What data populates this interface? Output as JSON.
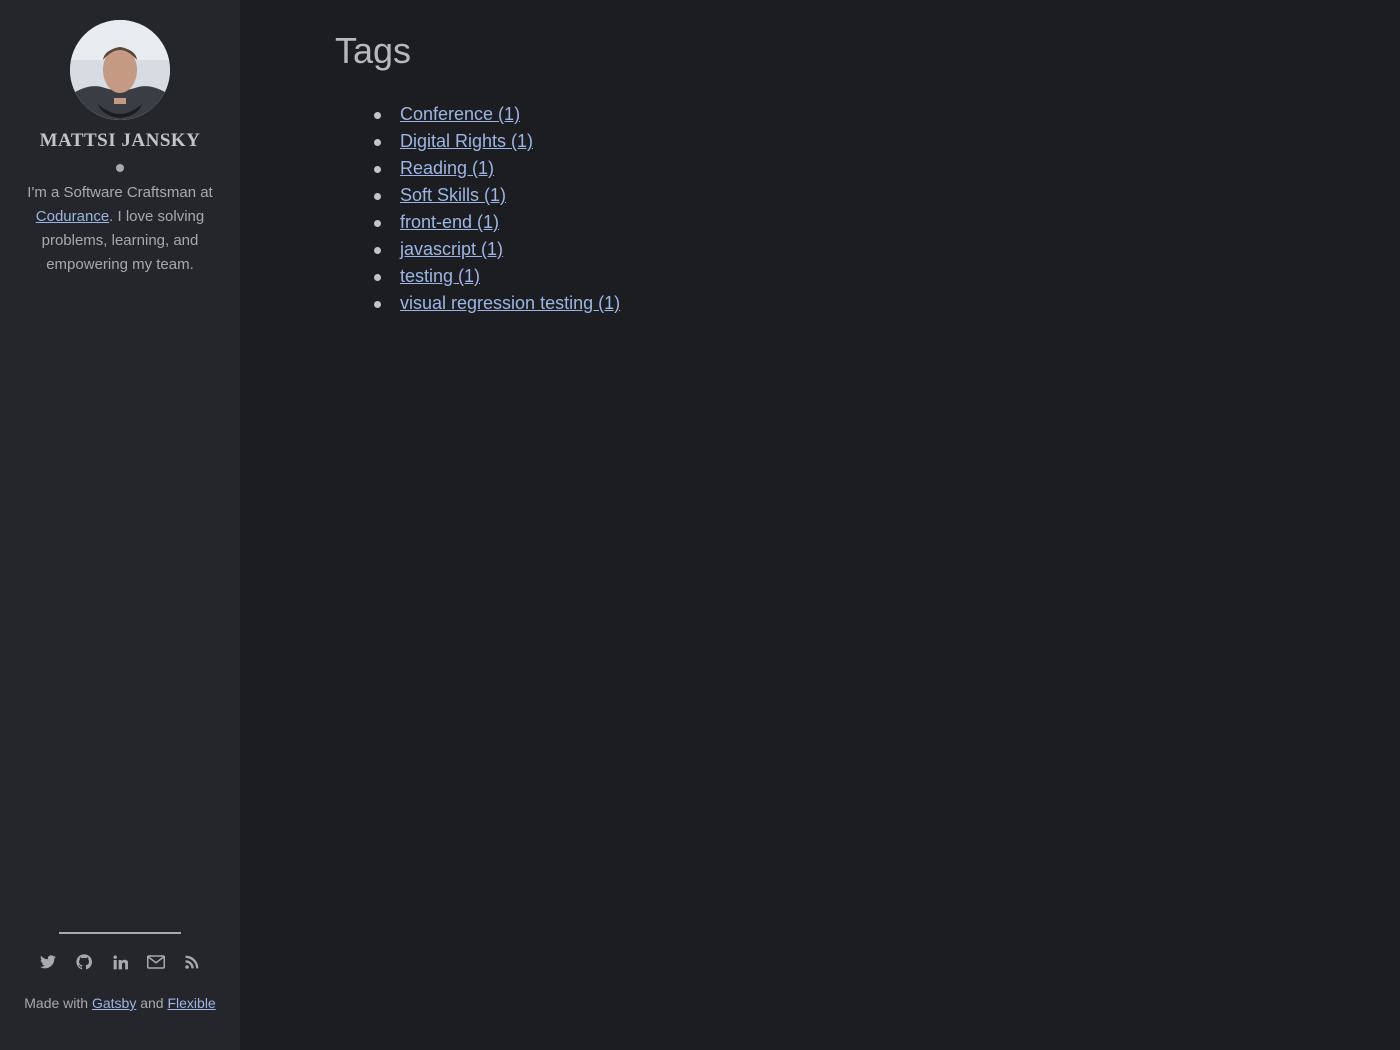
{
  "sidebar": {
    "author_name": "MATTSI JANSKY",
    "bio_prefix": "I'm a Software Craftsman at ",
    "bio_link": "Codurance",
    "bio_suffix": ". I love solving problems, learning, and empowering my team.",
    "social_icons": [
      "twitter-icon",
      "github-icon",
      "linkedin-icon",
      "email-icon",
      "rss-icon"
    ],
    "footer": {
      "made_with": "Made with ",
      "link1": "Gatsby",
      "and": " and ",
      "link2": "Flexible"
    }
  },
  "main": {
    "title": "Tags",
    "tags": [
      "Conference (1)",
      "Digital Rights (1)",
      "Reading (1)",
      "Soft Skills (1)",
      "front-end (1)",
      "javascript (1)",
      "testing (1)",
      "visual regression testing (1)"
    ]
  },
  "colors": {
    "background": "#1c1d21",
    "sidebar": "#25262b",
    "link": "#9db5e4",
    "text": "#a8a9ad"
  }
}
